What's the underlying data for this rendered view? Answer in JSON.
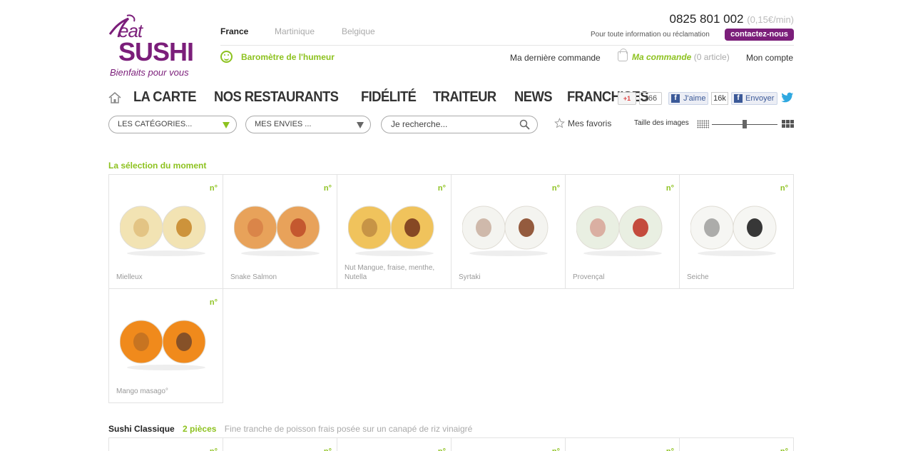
{
  "logo": {
    "eat": "eat",
    "sushi": "SUSHI",
    "tagline": "Bienfaits pour vous"
  },
  "countries": [
    "France",
    "Martinique",
    "Belgique"
  ],
  "humeur": "Baromètre de l'humeur",
  "phone": {
    "number": "0825 801 002",
    "price": "(0,15€/min)"
  },
  "info": "Pour toute information ou réclamation",
  "contact": "contactez-nous",
  "account": {
    "derniere": "Ma dernière commande",
    "commande": "Ma commande",
    "article": "(0 article)",
    "compte": "Mon compte"
  },
  "nav": [
    "LA CARTE",
    "NOS RESTAURANTS",
    "FIDÉLITÉ",
    "TRAITEUR",
    "NEWS",
    "FRANCHISES"
  ],
  "social": {
    "gplus": "+1",
    "gplus_count": "266",
    "fb_like": "J'aime",
    "fb_count": "16k",
    "fb_send": "Envoyer",
    "fb_f": "f"
  },
  "filters": {
    "categories": "LES CATÉGORIES...",
    "envies": "MES ENVIES ...",
    "search": "Je recherche...",
    "favoris": "Mes favoris",
    "taille": "Taille des images",
    "taille_level": 0.5
  },
  "selection": {
    "title": "La sélection du moment",
    "new_badge": "n°",
    "items": [
      {
        "name": "Mielleux",
        "color": "#f2e3b3",
        "filling": "#c98a2e"
      },
      {
        "name": "Snake Salmon",
        "color": "#e8a25a",
        "filling": "#c0502a"
      },
      {
        "name": "Nut Mangue, fraise, menthe, Nutella",
        "color": "#f0c35c",
        "filling": "#7a3b1e"
      },
      {
        "name": "Syrtaki",
        "color": "#f4f4f0",
        "filling": "#8a4a2a"
      },
      {
        "name": "Provençal",
        "color": "#e9efe2",
        "filling": "#c0392b"
      },
      {
        "name": "Seiche",
        "color": "#f6f6f3",
        "filling": "#222222"
      },
      {
        "name": "Mango masago°",
        "color": "#f08a1c",
        "filling": "#7a4a2a"
      }
    ]
  },
  "section2": {
    "title": "Sushi Classique",
    "pieces": "2 pièces",
    "desc": "Fine tranche de poisson frais posée sur un canapé de riz vinaigré"
  }
}
